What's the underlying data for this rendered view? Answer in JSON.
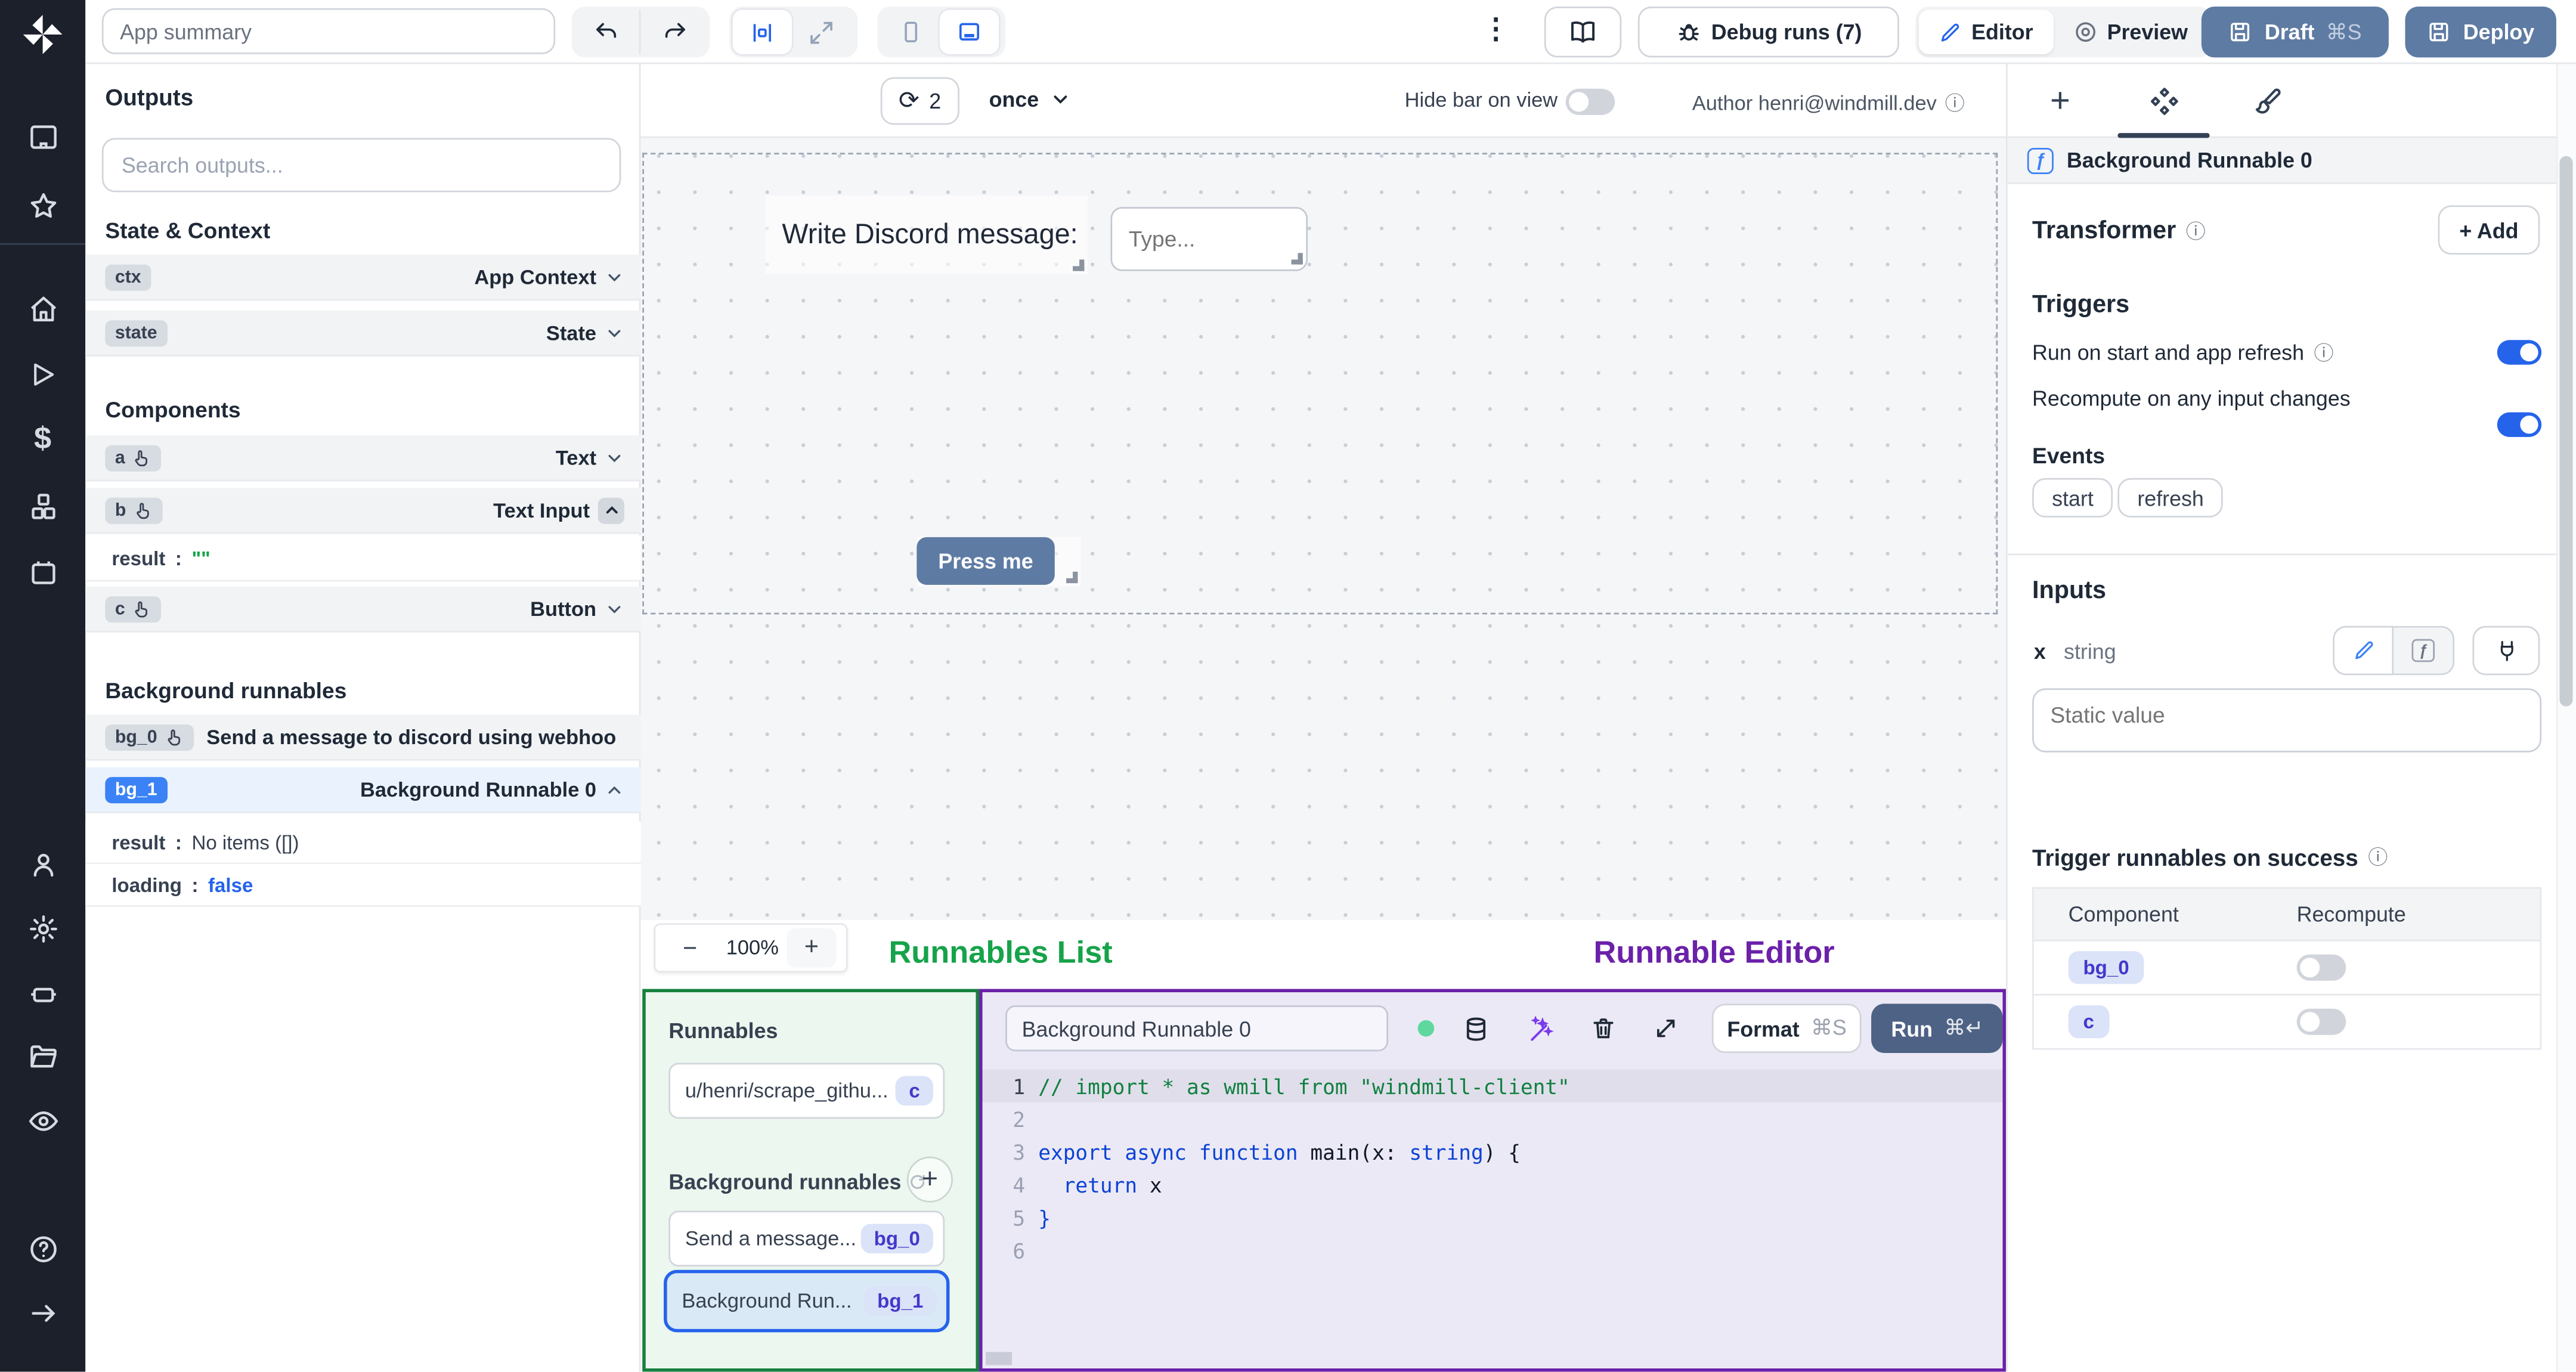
{
  "icons": {
    "kebab": "⋮",
    "refresh": "⟳",
    "info": "ⓘ",
    "dollar": "$",
    "plus": "+",
    "minus": "−",
    "help": "?",
    "fn": "ƒ"
  },
  "topbar": {
    "app_summary_placeholder": "App summary",
    "debug_runs": "Debug runs (7)",
    "editor": "Editor",
    "preview": "Preview",
    "draft": "Draft",
    "draft_kbd": "⌘S",
    "deploy": "Deploy"
  },
  "outputs": {
    "title": "Outputs",
    "search_placeholder": "Search outputs...",
    "state_context_title": "State & Context",
    "ctx_id": "ctx",
    "ctx_type": "App Context",
    "state_id": "state",
    "state_type": "State",
    "components_title": "Components",
    "a_id": "a",
    "a_type": "Text",
    "b_id": "b",
    "b_type": "Text Input",
    "b_result_key": "result",
    "b_result_val": "\"\"",
    "c_id": "c",
    "c_type": "Button",
    "bg_title": "Background runnables",
    "bg0_id": "bg_0",
    "bg0_label": "Send a message to discord using webhoo",
    "bg1_id": "bg_1",
    "bg1_label": "Background Runnable 0",
    "bg1_result_key": "result",
    "bg1_result_val": "No items ([])",
    "bg1_loading_key": "loading",
    "bg1_loading_val": "false"
  },
  "canvas": {
    "refresh_count": "2",
    "interval": "once",
    "hide_bar_label": "Hide bar on view",
    "author": "Author henri@windmill.dev",
    "text_component": "Write Discord message:",
    "input_placeholder": "Type...",
    "button_label": "Press me",
    "zoom_level": "100%"
  },
  "annotations": {
    "runnables_list": "Runnables List",
    "runnable_editor": "Runnable Editor",
    "green": "#16a34a",
    "purple": "#6b21a8"
  },
  "runnables": {
    "title": "Runnables",
    "item1_label": "u/henri/scrape_githu...",
    "item1_badge": "c",
    "bg_title": "Background runnables",
    "item2_label": "Send a message...",
    "item2_badge": "bg_0",
    "item3_label": "Background Run...",
    "item3_badge": "bg_1"
  },
  "editor": {
    "name_value": "Background Runnable 0",
    "format": "Format",
    "format_kbd": "⌘S",
    "run": "Run",
    "run_kbd": "⌘↵",
    "gutter": [
      "1",
      "2",
      "3",
      "4",
      "5",
      "6"
    ],
    "code": {
      "l1": "// import * as wmill from \"windmill-client\"",
      "l3_kw": "export async function ",
      "l3_name": "main",
      "l3_p1": "(x: ",
      "l3_type": "string",
      "l3_p2": ") {",
      "l4_kw": "  return",
      "l4_rest": " x",
      "l5": "}"
    }
  },
  "right": {
    "component_header": "Background Runnable 0",
    "transformer_title": "Transformer",
    "add_label": "+ Add",
    "triggers_title": "Triggers",
    "run_on_start": "Run on start and app refresh",
    "recompute_any": "Recompute on any input changes",
    "events_title": "Events",
    "chip_start": "start",
    "chip_refresh": "refresh",
    "inputs_title": "Inputs",
    "x_key": "x",
    "x_type": "string",
    "static_placeholder": "Static value",
    "trigger_success_title": "Trigger runnables on success",
    "col_component": "Component",
    "col_recompute": "Recompute",
    "row1_badge": "bg_0",
    "row2_badge": "c"
  },
  "colors": {
    "accent_blue": "#2563eb",
    "slate_button": "#5e7ba3",
    "toggle_off": "#d1d5db"
  }
}
